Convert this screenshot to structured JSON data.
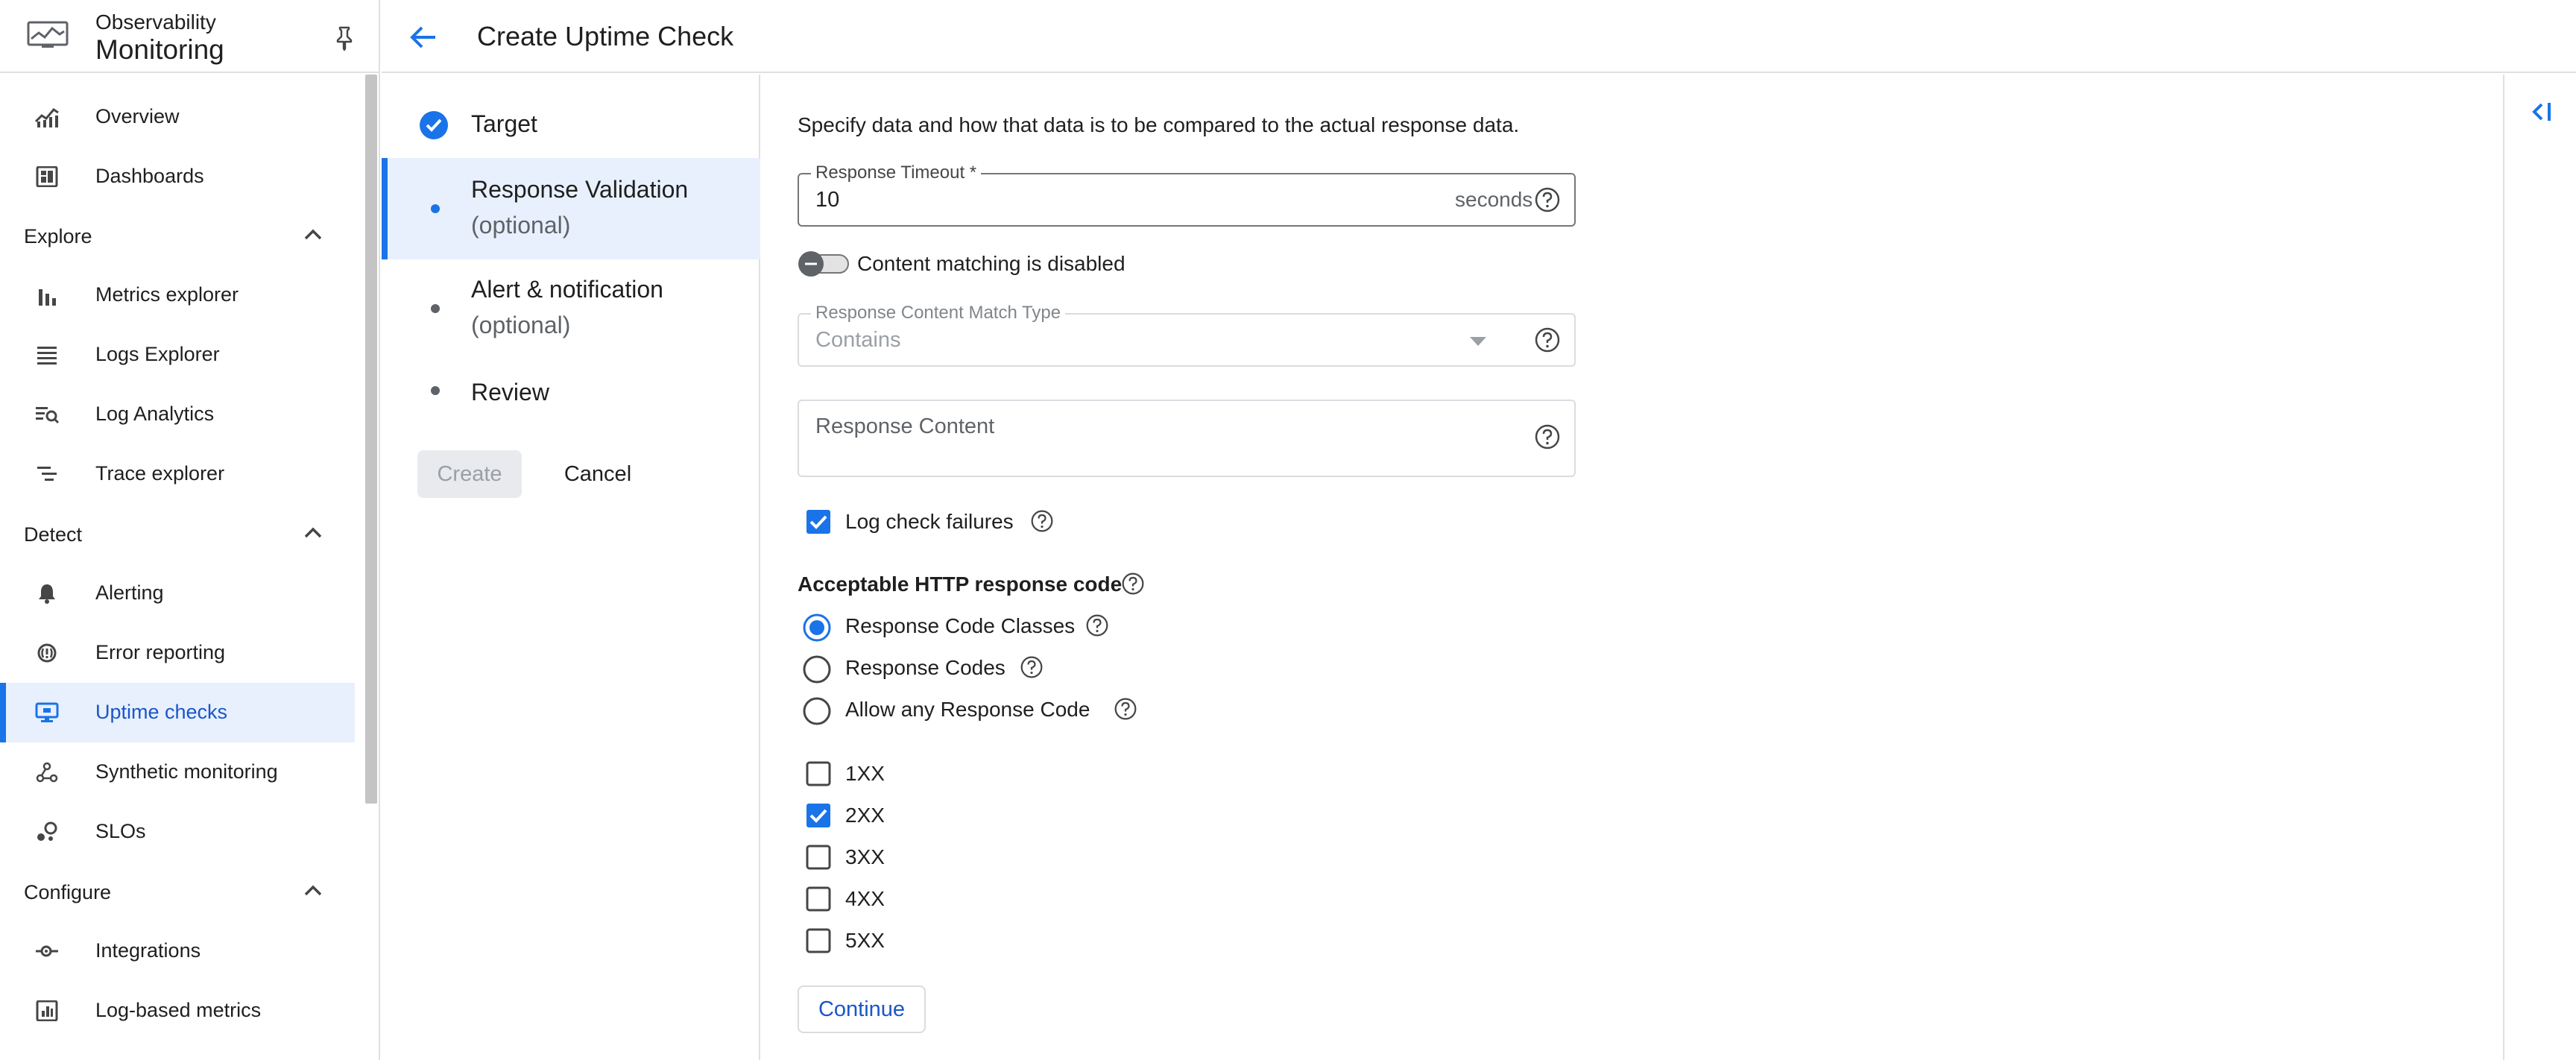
{
  "brand": {
    "subtitle": "Observability",
    "title": "Monitoring"
  },
  "header": {
    "title": "Create Uptime Check"
  },
  "sidebar": {
    "items": [
      {
        "label": "Overview",
        "icon": "overview-chart-icon"
      },
      {
        "label": "Dashboards",
        "icon": "dashboard-icon"
      },
      {
        "label": "Metrics explorer",
        "icon": "bar-chart-icon"
      },
      {
        "label": "Logs Explorer",
        "icon": "list-icon"
      },
      {
        "label": "Log Analytics",
        "icon": "log-search-icon"
      },
      {
        "label": "Trace explorer",
        "icon": "trace-icon"
      },
      {
        "label": "Alerting",
        "icon": "bell-icon"
      },
      {
        "label": "Error reporting",
        "icon": "error-reporting-icon"
      },
      {
        "label": "Uptime checks",
        "icon": "monitor-icon",
        "active": true
      },
      {
        "label": "Synthetic monitoring",
        "icon": "synthetic-icon"
      },
      {
        "label": "SLOs",
        "icon": "slo-icon"
      },
      {
        "label": "Integrations",
        "icon": "integrations-icon"
      },
      {
        "label": "Log-based metrics",
        "icon": "log-metrics-icon"
      }
    ],
    "sections": [
      "Explore",
      "Detect",
      "Configure"
    ]
  },
  "stepper": {
    "steps": [
      {
        "title": "Target",
        "subtitle": "",
        "state": "done"
      },
      {
        "title": "Response Validation",
        "subtitle": "(optional)",
        "state": "active"
      },
      {
        "title": "Alert & notification",
        "subtitle": "(optional)",
        "state": "pending"
      },
      {
        "title": "Review",
        "subtitle": "",
        "state": "pending"
      }
    ],
    "create_label": "Create",
    "cancel_label": "Cancel"
  },
  "form": {
    "intro": "Specify data and how that data is to be compared to the actual response data.",
    "timeout": {
      "label": "Response Timeout *",
      "value": "10",
      "suffix": "seconds"
    },
    "content_matching": {
      "label": "Content matching is disabled",
      "enabled": false
    },
    "match_type": {
      "label": "Response Content Match Type",
      "value": "Contains"
    },
    "response_content": {
      "placeholder": "Response Content"
    },
    "log_failures": {
      "label": "Log check failures",
      "checked": true
    },
    "http_code": {
      "title": "Acceptable HTTP response code",
      "options": [
        {
          "label": "Response Code Classes",
          "selected": true
        },
        {
          "label": "Response Codes",
          "selected": false
        },
        {
          "label": "Allow any Response Code",
          "selected": false
        }
      ],
      "classes": [
        {
          "label": "1XX",
          "checked": false
        },
        {
          "label": "2XX",
          "checked": true
        },
        {
          "label": "3XX",
          "checked": false
        },
        {
          "label": "4XX",
          "checked": false
        },
        {
          "label": "5XX",
          "checked": false
        }
      ]
    },
    "continue_label": "Continue"
  },
  "colors": {
    "accent": "#1a73e8",
    "active_bg": "#e8f0fe",
    "text": "#1f1f1f",
    "muted": "#5f6368"
  }
}
